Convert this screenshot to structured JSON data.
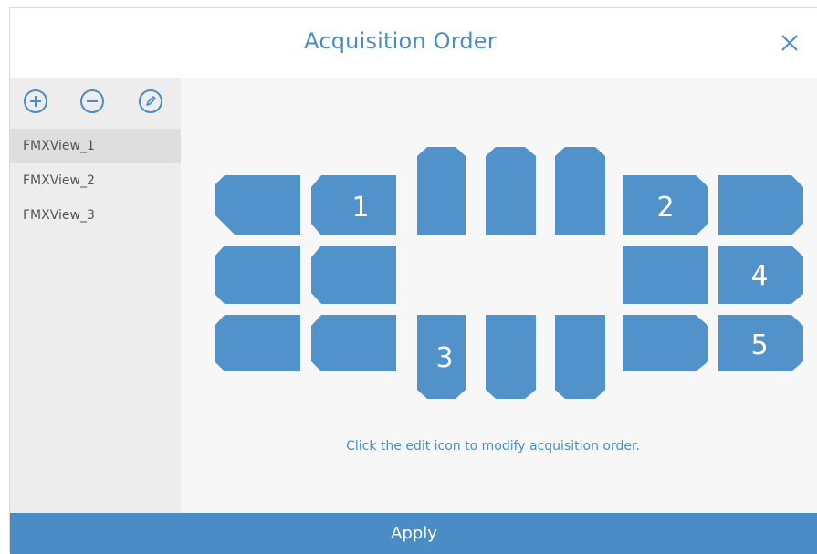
{
  "dialog": {
    "title": "Acquisition Order",
    "close_icon": "close-icon",
    "apply_label": "Apply"
  },
  "sidebar": {
    "tools": [
      {
        "name": "add-view",
        "icon": "plus-circle-icon"
      },
      {
        "name": "remove-view",
        "icon": "minus-circle-icon"
      },
      {
        "name": "edit-order",
        "icon": "edit-pen-icon"
      }
    ],
    "items": [
      {
        "label": "FMXView_1",
        "selected": true
      },
      {
        "label": "FMXView_2",
        "selected": false
      },
      {
        "label": "FMXView_3",
        "selected": false
      }
    ]
  },
  "main": {
    "hint": "Click the edit icon to modify acquisition order.",
    "order_labels": {
      "upper_left_near": "1",
      "upper_right_near": "2",
      "lower_anterior_left": "3",
      "right_middle": "4",
      "lower_right_far": "5"
    }
  },
  "colors": {
    "accent": "#4a8cc6",
    "tile": "#5192cb",
    "sidebar": "#ededed",
    "selected": "#dedede",
    "main_bg": "#f7f7f7"
  }
}
